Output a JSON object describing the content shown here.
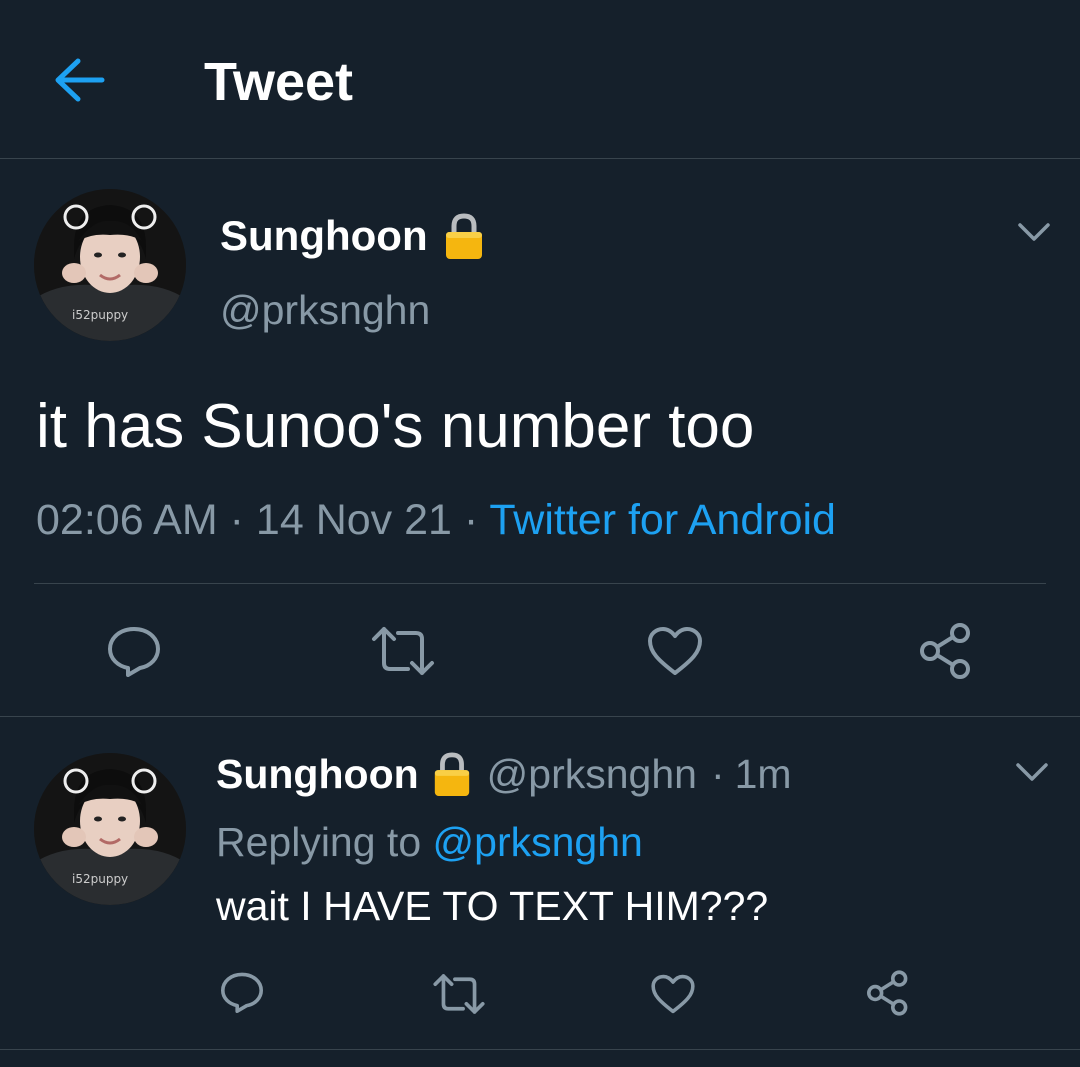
{
  "header": {
    "title": "Tweet",
    "back_icon": "arrow-left-icon"
  },
  "colors": {
    "background": "#15202b",
    "accent": "#1da1f2",
    "muted": "#8899a6",
    "divider": "#38444d"
  },
  "main_tweet": {
    "display_name": "Sunghoon",
    "lock_icon": "lock-icon",
    "handle": "@prksnghn",
    "text": "it has Sunoo's number too",
    "time": "02:06 AM",
    "separator": "·",
    "date": "14 Nov 21",
    "source": "Twitter for Android",
    "avatar_watermark": "i52puppy",
    "actions": [
      "reply-icon",
      "retweet-icon",
      "like-icon",
      "share-icon"
    ]
  },
  "reply_tweet": {
    "display_name": "Sunghoon",
    "handle": "@prksnghn",
    "separator": "·",
    "age": "1m",
    "replying_prefix": "Replying to",
    "replying_handle": "@prksnghn",
    "text": "wait I HAVE TO TEXT HIM???",
    "avatar_watermark": "i52puppy",
    "actions": [
      "reply-icon",
      "retweet-icon",
      "like-icon",
      "share-icon"
    ]
  }
}
